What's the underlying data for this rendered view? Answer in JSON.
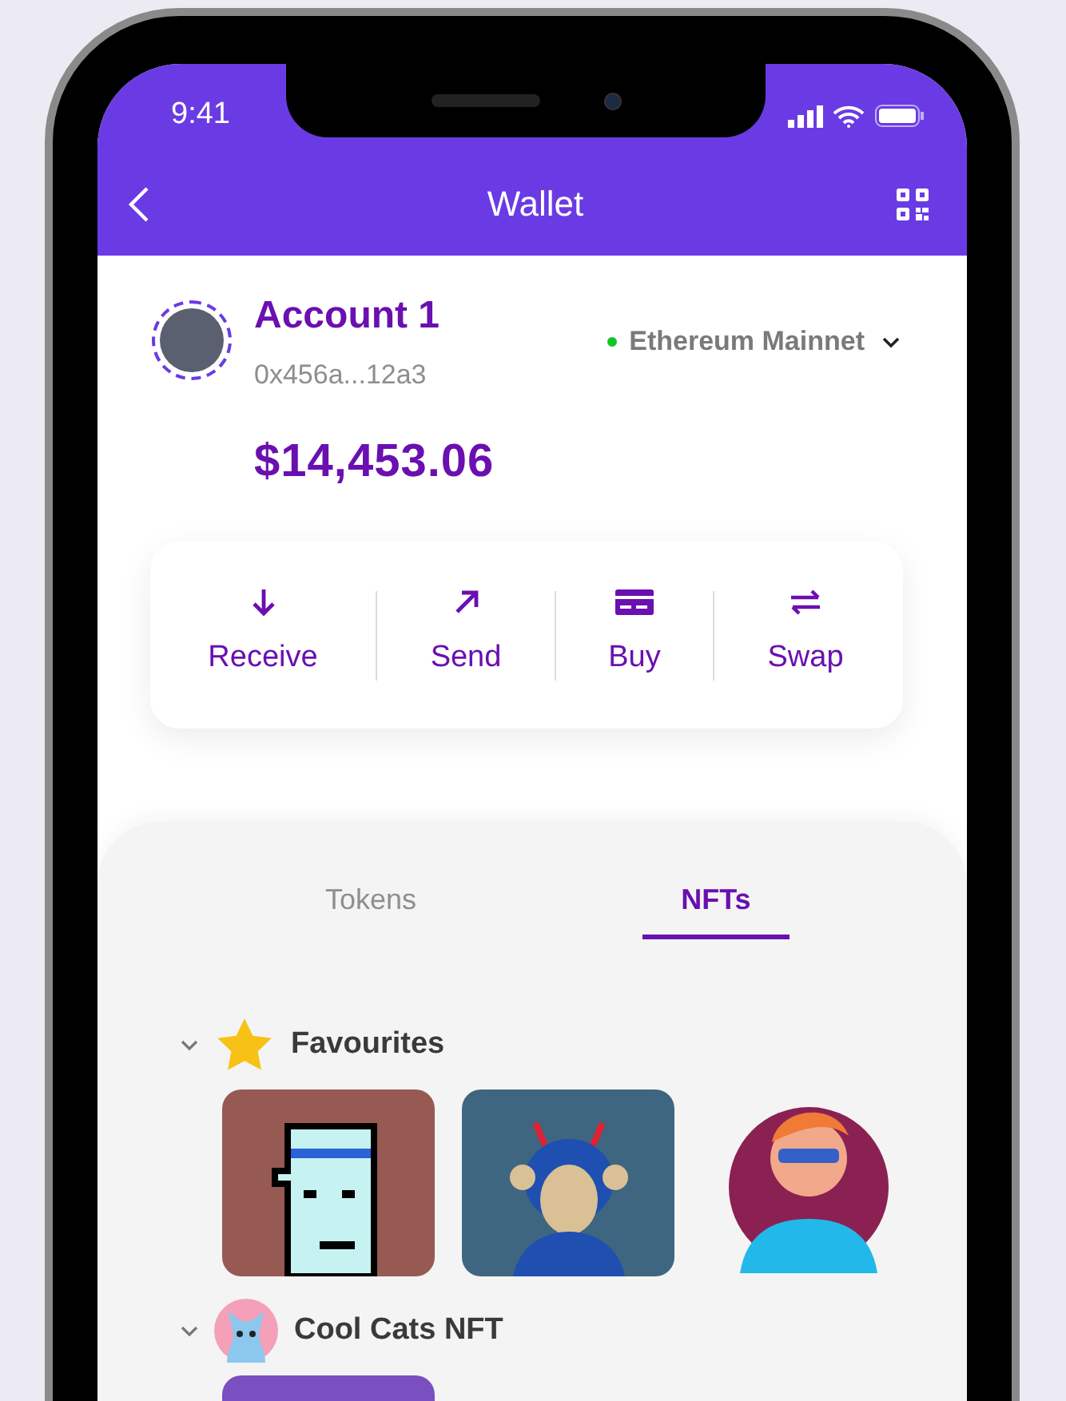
{
  "status_bar": {
    "time": "9:41"
  },
  "header": {
    "title": "Wallet"
  },
  "account": {
    "name": "Account 1",
    "address": "0x456a...12a3",
    "balance": "$14,453.06",
    "network": {
      "name": "Ethereum Mainnet",
      "connected": true
    }
  },
  "actions": [
    {
      "label": "Receive",
      "kind": "receive"
    },
    {
      "label": "Send",
      "kind": "send"
    },
    {
      "label": "Buy",
      "kind": "buy"
    },
    {
      "label": "Swap",
      "kind": "swap"
    }
  ],
  "tabs": [
    {
      "label": "Tokens",
      "selected": false
    },
    {
      "label": "NFTs",
      "selected": true
    }
  ],
  "collections": [
    {
      "name": "Favourites",
      "kind": "favourites",
      "expanded": true,
      "items": [
        {
          "kind": "pixel"
        },
        {
          "kind": "ape"
        },
        {
          "kind": "cartoon"
        }
      ]
    },
    {
      "name": "Cool Cats NFT",
      "kind": "collection",
      "expanded": true,
      "items": [
        {
          "kind": "abstract"
        }
      ]
    }
  ]
}
